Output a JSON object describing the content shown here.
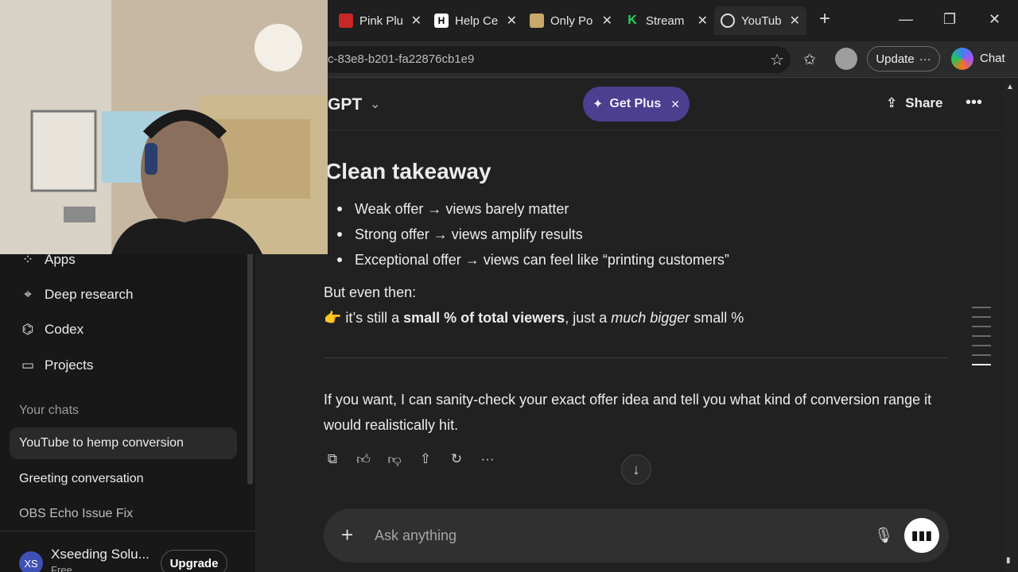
{
  "browser": {
    "tabs": [
      {
        "label": "Pink Plu",
        "favicon_color": "#c62828"
      },
      {
        "label": "Help Ce",
        "favicon_color": "#ffffff",
        "favicon_glyph": "H"
      },
      {
        "label": "Only Po",
        "favicon_color": "#c8a96a"
      },
      {
        "label": "Stream",
        "favicon_color": "#1ed760",
        "favicon_glyph": "K"
      },
      {
        "label": "YouTub",
        "favicon_color": "#e0e0e0",
        "active": true
      }
    ],
    "url": "c-83e8-b201-fa22876cb1e9",
    "update_label": "Update",
    "chat_label": "Chat"
  },
  "header": {
    "model_title": "GPT",
    "get_plus_label": "Get Plus",
    "share_label": "Share"
  },
  "sidebar": {
    "items": [
      {
        "label": "Apps",
        "icon": "apps-icon"
      },
      {
        "label": "Deep research",
        "icon": "telescope-icon"
      },
      {
        "label": "Codex",
        "icon": "codex-icon"
      },
      {
        "label": "Projects",
        "icon": "folder-icon"
      }
    ],
    "section_title": "Your chats",
    "chats": [
      {
        "label": "YouTube to hemp conversion",
        "active": true
      },
      {
        "label": "Greeting conversation"
      },
      {
        "label": "OBS Echo Issue Fix"
      }
    ],
    "user": {
      "initials": "XS",
      "name": "Xseeding Solu...",
      "plan": "Free"
    },
    "upgrade_label": "Upgrade"
  },
  "content": {
    "heading": "Clean takeaway",
    "bullets": [
      "Weak offer → views barely matter",
      "Strong offer → views amplify results",
      "Exceptional offer → views can feel like “printing customers”"
    ],
    "but_line": "But even then:",
    "emphasis": {
      "emoji": "👉",
      "pre": " it’s still a ",
      "bold": "small % of total viewers",
      "mid": ", just a ",
      "italic": "much bigger",
      "post": " small %"
    },
    "final": "If you want, I can sanity-check your exact offer idea and tell you what kind of conversion range it would realistically hit."
  },
  "composer": {
    "placeholder": "Ask anything"
  }
}
